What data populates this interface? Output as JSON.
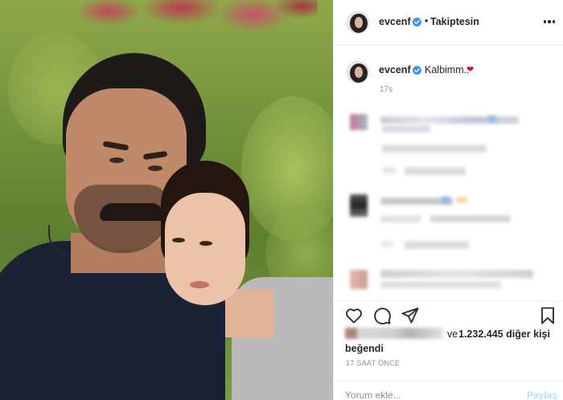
{
  "post": {
    "username": "evcenf",
    "verified": true,
    "follow_status": "Takiptesin",
    "separator": "•"
  },
  "caption": {
    "username": "evcenf",
    "text": "Kalbimm..",
    "emoji": "❤",
    "age": "17s"
  },
  "likes": {
    "prefix": "ve",
    "count_text": "1.232.445 diğer kişi",
    "suffix": "beğendi"
  },
  "timestamp": "17 SAAT ÖNCE",
  "comment_box": {
    "placeholder": "Yorum ekle...",
    "post_label": "Paylaş"
  },
  "colors": {
    "text": "#262626",
    "secondary": "#8e8e8e",
    "verified_badge": "#3897f0",
    "post_button_disabled": "#b2dffc",
    "heart": "#c0152d"
  },
  "icons": {
    "more": "more-options-icon",
    "like": "heart-outline-icon",
    "comment": "comment-bubble-icon",
    "share": "paper-plane-icon",
    "save": "bookmark-icon"
  }
}
